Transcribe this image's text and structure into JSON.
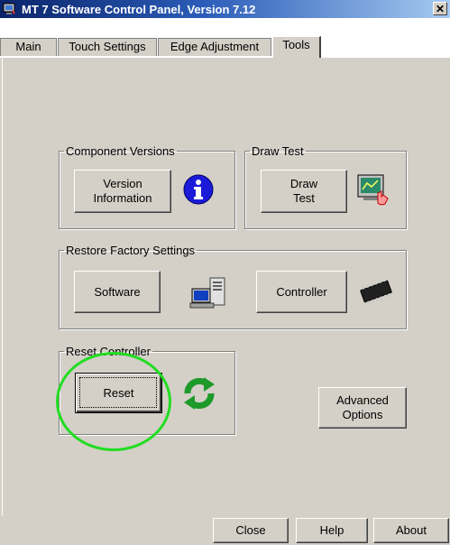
{
  "window": {
    "title": "MT 7 Software Control Panel, Version 7.12",
    "close_glyph": "✕"
  },
  "tabs": [
    {
      "label": "Main"
    },
    {
      "label": "Touch Settings"
    },
    {
      "label": "Edge Adjustment"
    },
    {
      "label": "Tools",
      "active": true
    }
  ],
  "groups": {
    "component_versions": {
      "legend": "Component Versions",
      "button_line1": "Version",
      "button_line2": "Information",
      "icon": "info-icon"
    },
    "draw_test": {
      "legend": "Draw Test",
      "button_line1": "Draw",
      "button_line2": "Test",
      "icon": "monitor-touch-icon"
    },
    "restore_factory": {
      "legend": "Restore Factory Settings",
      "software_label": "Software",
      "controller_label": "Controller",
      "software_icon": "computer-icon",
      "controller_icon": "chip-icon"
    },
    "reset_controller": {
      "legend": "Reset Controller",
      "reset_label": "Reset",
      "icon": "refresh-arrows-icon"
    }
  },
  "advanced": {
    "line1": "Advanced",
    "line2": "Options"
  },
  "footer": {
    "close_label": "Close",
    "help_label": "Help",
    "about_label": "About"
  },
  "colors": {
    "highlight_circle": "#22dd22",
    "titlebar": "#0a246a",
    "info_icon": "#1a1ad8"
  }
}
